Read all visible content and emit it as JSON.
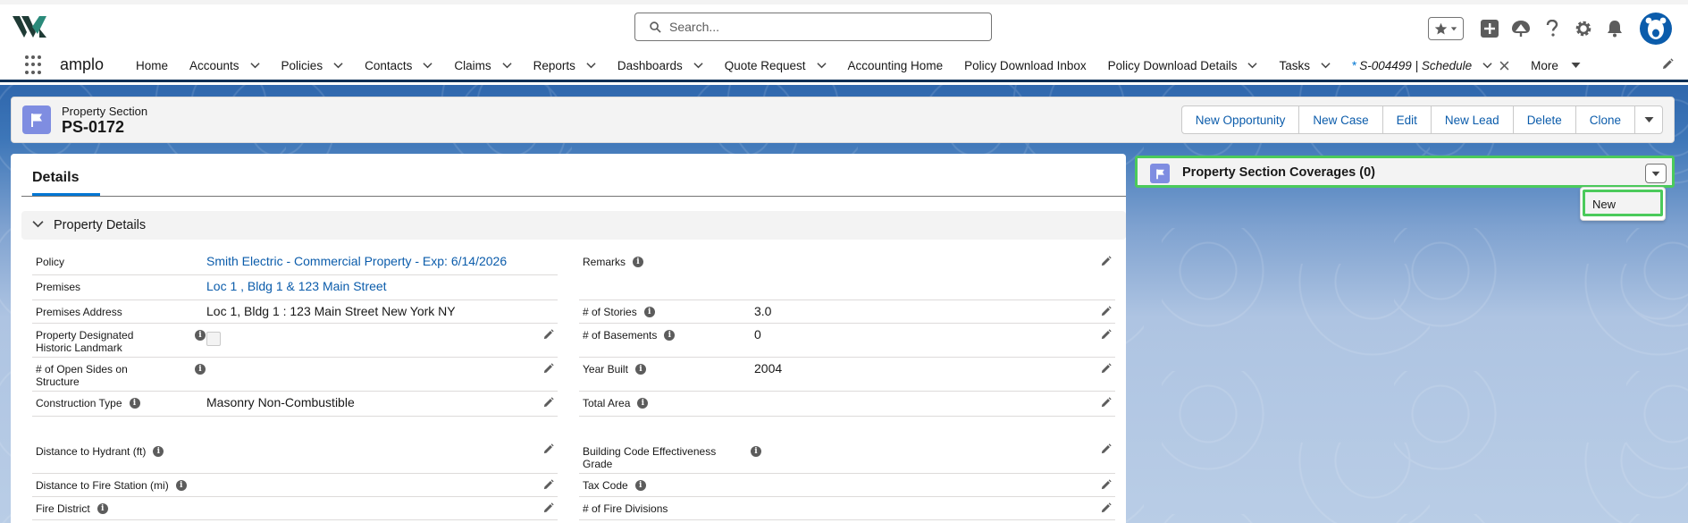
{
  "header": {
    "app_logo": "amplo-logo",
    "search_placeholder": "Search...",
    "icons": [
      "favorites-star-icon",
      "add-icon",
      "trailhead-icon",
      "help-icon",
      "setup-gear-icon",
      "notifications-bell-icon",
      "user-avatar"
    ]
  },
  "nav": {
    "app_name": "amplo",
    "items": [
      {
        "label": "Home",
        "chevron": false
      },
      {
        "label": "Accounts",
        "chevron": true
      },
      {
        "label": "Policies",
        "chevron": true
      },
      {
        "label": "Contacts",
        "chevron": true
      },
      {
        "label": "Claims",
        "chevron": true
      },
      {
        "label": "Reports",
        "chevron": true
      },
      {
        "label": "Dashboards",
        "chevron": true
      },
      {
        "label": "Quote Request",
        "chevron": true
      },
      {
        "label": "Accounting Home",
        "chevron": false
      },
      {
        "label": "Policy Download Inbox",
        "chevron": false
      },
      {
        "label": "Policy Download Details",
        "chevron": true
      },
      {
        "label": "Tasks",
        "chevron": true
      }
    ],
    "active_tab": {
      "star": "*",
      "label": "S-004499 | Schedule"
    },
    "more_label": "More"
  },
  "record": {
    "object_type": "Property Section",
    "name": "PS-0172",
    "actions": [
      "New Opportunity",
      "New Case",
      "Edit",
      "New Lead",
      "Delete",
      "Clone"
    ]
  },
  "details": {
    "tab_label": "Details",
    "section_title": "Property Details",
    "left_fields": [
      {
        "label": "Policy",
        "value": "Smith Electric - Commercial Property - Exp: 6/14/2026",
        "link": true
      },
      {
        "label": "Premises",
        "value": "Loc 1 , Bldg 1 & 123 Main Street",
        "link": true
      },
      {
        "label": "Premises Address",
        "value": "Loc 1, Bldg 1 : 123 Main Street New York NY"
      },
      {
        "label": "Property Designated Historic Landmark",
        "value": ""
      },
      {
        "label": "# of Open Sides on Structure",
        "value": ""
      },
      {
        "label": "Construction Type",
        "value": "Masonry Non-Combustible"
      },
      {
        "label": "Distance to Hydrant (ft)",
        "value": ""
      },
      {
        "label": "Distance to Fire Station (mi)",
        "value": ""
      },
      {
        "label": "Fire District",
        "value": ""
      }
    ],
    "right_fields": [
      {
        "label": "Remarks",
        "value": ""
      },
      {
        "label": "# of Stories",
        "value": "3.0"
      },
      {
        "label": "# of Basements",
        "value": "0"
      },
      {
        "label": "Year Built",
        "value": "2004"
      },
      {
        "label": "Total Area",
        "value": ""
      },
      {
        "label": "Building Code Effectiveness Grade",
        "value": ""
      },
      {
        "label": "Tax Code",
        "value": ""
      },
      {
        "label": "# of Fire Divisions",
        "value": ""
      }
    ]
  },
  "related": {
    "title": "Property Section Coverages (0)",
    "menu_item": "New"
  },
  "colors": {
    "brand_blue": "#0b5cab",
    "accent_blue": "#0176d3",
    "highlight_green": "#4bca5b",
    "record_icon": "#7f8de1",
    "nav_underline": "#0d2f55"
  }
}
